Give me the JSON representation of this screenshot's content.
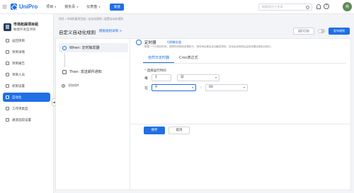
{
  "app": {
    "name": "UniPro",
    "search_placeholder": "搜索项目/工作项",
    "avatar_initial": "杨"
  },
  "top_nav": [
    {
      "label": "项目"
    },
    {
      "label": "我负责"
    },
    {
      "label": "仪表盘"
    }
  ],
  "new_button": "新建",
  "sidebar": {
    "project_name": "市场拓展项目组",
    "project_sub": "敏捷开发型项目",
    "items": [
      {
        "label": "返回项目",
        "icon": "back-icon"
      },
      {
        "label": "项目详情",
        "icon": "detail-icon"
      },
      {
        "label": "项目报告",
        "icon": "report-icon"
      },
      {
        "label": "项目人员",
        "icon": "people-icon"
      },
      {
        "label": "权限设置",
        "icon": "permission-icon"
      },
      {
        "label": "自动化",
        "icon": "automation-icon",
        "active": true
      },
      {
        "label": "工作项类型",
        "icon": "type-icon"
      },
      {
        "label": "通道追踪设置",
        "icon": "tracking-icon"
      }
    ]
  },
  "breadcrumb": "项目 / 市场拓展项目组 / 自动化规则 / 配置自动化规则",
  "page": {
    "title": "自定义自动化规则",
    "title_link": "模版规则详情 >",
    "run_log": "运行日志",
    "publish": "发布规则"
  },
  "steps": {
    "when": "When: 定时触发器",
    "then": "Then: 发送邮件通知",
    "add_action": "添加组件"
  },
  "panel": {
    "title": "定时器",
    "switch_link": "切换触发器",
    "description": "根据一个计划的时间，按照时间规则定期执行，到时间后便会自动触发规则，自动启动规则后会按设置定期自动执行。",
    "tabs": [
      {
        "label": "自然日定时器",
        "active": true
      },
      {
        "label": "Cron表达式"
      }
    ],
    "field_label": "选择运行时间",
    "required_mark": "*",
    "every_label": "每",
    "every_value": "1",
    "unit_value": "日",
    "at_label": "在",
    "hour_value": "9",
    "colon": ":",
    "minute_value": "00"
  },
  "actions": {
    "save": "保存",
    "cancel": "取消"
  }
}
